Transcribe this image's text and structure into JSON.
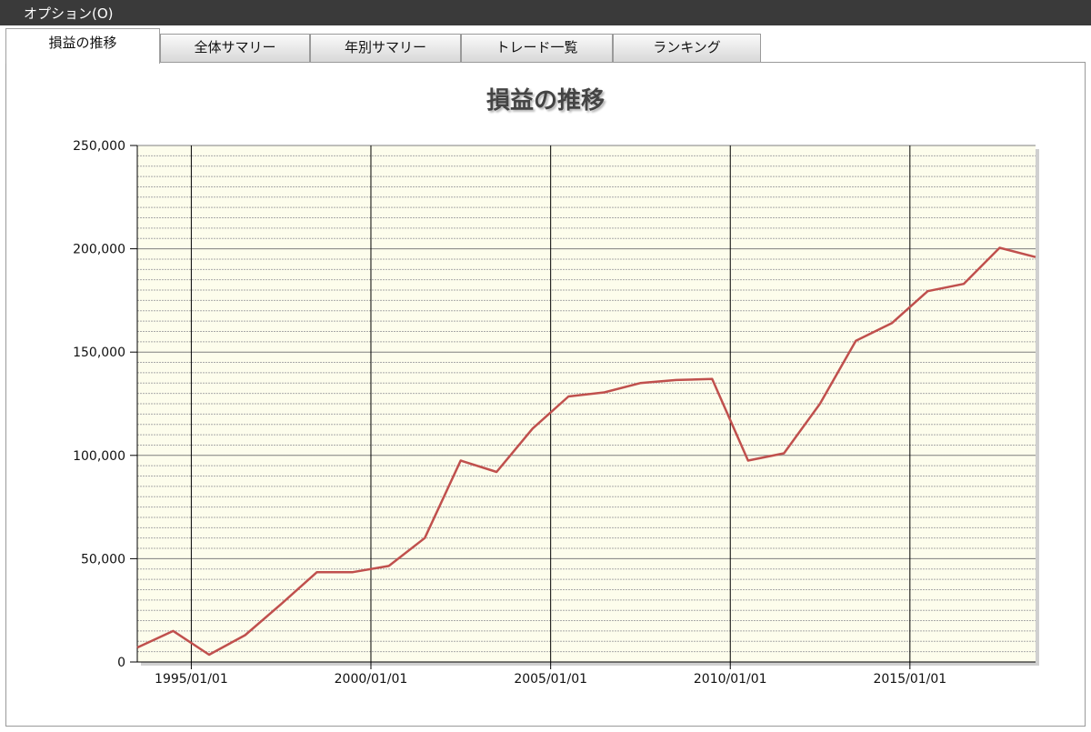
{
  "menu": {
    "options_label": "オプション(O)"
  },
  "tabs": [
    {
      "label": "損益の推移",
      "active": true
    },
    {
      "label": "全体サマリー",
      "active": false
    },
    {
      "label": "年別サマリー",
      "active": false
    },
    {
      "label": "トレード一覧",
      "active": false
    },
    {
      "label": "ランキング",
      "active": false
    }
  ],
  "colors": {
    "plot_background": "#fdfdec",
    "line": "#c0504d",
    "menubar": "#3a3a3a"
  },
  "chart_data": {
    "type": "line",
    "title": "損益の推移",
    "xlabel": "",
    "ylabel": "",
    "x_type": "date",
    "x_range": [
      "1993/07/01",
      "2018/07/01"
    ],
    "ylim": [
      0,
      250000
    ],
    "y_ticks": [
      {
        "value": 0,
        "label": "0"
      },
      {
        "value": 50000,
        "label": "50,000"
      },
      {
        "value": 100000,
        "label": "100,000"
      },
      {
        "value": 150000,
        "label": "150,000"
      },
      {
        "value": 200000,
        "label": "200,000"
      },
      {
        "value": 250000,
        "label": "250,000"
      }
    ],
    "x_ticks": [
      "1995/01/01",
      "2000/01/01",
      "2005/01/01",
      "2010/01/01",
      "2015/01/01"
    ],
    "minor_gridlines": true,
    "grid": true,
    "legend": "none",
    "series": [
      {
        "x": [
          "1993/07/01",
          "1994/07/01",
          "1995/07/01",
          "1996/07/01",
          "1997/07/01",
          "1998/07/01",
          "1999/07/01",
          "2000/07/01",
          "2001/07/01",
          "2002/07/01",
          "2003/07/01",
          "2004/07/01",
          "2005/07/01",
          "2006/07/01",
          "2007/07/01",
          "2008/07/01",
          "2009/07/01",
          "2010/07/01",
          "2011/07/01",
          "2012/07/01",
          "2013/07/01",
          "2014/07/01",
          "2015/07/01",
          "2016/07/01",
          "2017/07/01",
          "2018/07/01"
        ],
        "values": [
          7000,
          15000,
          3500,
          13000,
          28000,
          43500,
          43500,
          46500,
          60000,
          97500,
          92000,
          113000,
          128500,
          130500,
          135000,
          136500,
          137000,
          97500,
          101000,
          125000,
          155500,
          164000,
          179500,
          183000,
          200500,
          196000
        ]
      }
    ]
  }
}
